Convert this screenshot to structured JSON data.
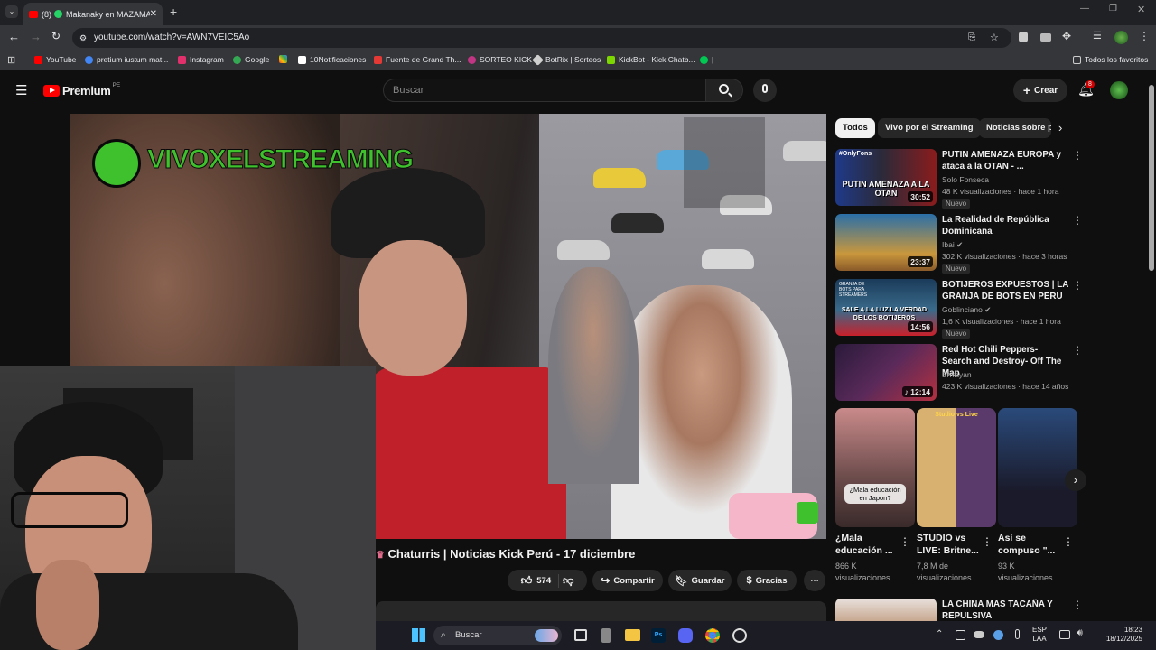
{
  "browser": {
    "tab_title": "Makanaky en MAZAMAN",
    "tab_count_badge": "(8)",
    "url": "youtube.com/watch?v=AWN7VEIC5Ao",
    "bookmarks": [
      "YouTube",
      "pretium iustum mat...",
      "Instagram",
      "Google",
      "10Notificaciones",
      "Fuente de Grand Th...",
      "SORTEO KICK",
      "BotRix | Sorteos",
      "KickBot - Kick Chatb...",
      "Todos los favoritos"
    ],
    "bookmark_colors": [
      "#ff0000",
      "#4285f4",
      "#e1306c",
      "#34a853",
      "#ffffff",
      "#e53935",
      "#c13584",
      "#cfcfcf",
      "#7cd800",
      "#8ab4f8"
    ]
  },
  "youtube": {
    "logo_label": "Premium",
    "region": "PE",
    "search_placeholder": "Buscar",
    "create_label": "Crear",
    "notifications_count": "8"
  },
  "video": {
    "overlay_brand": "VIVOXELSTREAMING",
    "title": "Chaturris | Noticias Kick Perú - 17 diciembre",
    "likes": "574",
    "share_label": "Compartir",
    "save_label": "Guardar",
    "thanks_label": "Gracias"
  },
  "chips": [
    "Todos",
    "Vivo por el Streaming",
    "Noticias sobre p"
  ],
  "recommendations": [
    {
      "title": "PUTIN AMENAZA EUROPA y ataca a la OTAN - ...",
      "channel": "Solo Fonseca",
      "meta": "48 K visualizaciones · hace 1 hora",
      "badge": "Nuevo",
      "duration": "30:52",
      "thumb_text": "PUTIN AMENAZA A LA OTAN",
      "thumb_tag": "#OnlyFons",
      "colors": [
        "#8a1c1c",
        "#1f3a8a"
      ]
    },
    {
      "title": "La Realidad de República Dominicana",
      "channel": "Ibai",
      "meta": "302 K visualizaciones · hace 3 horas",
      "badge": "Nuevo",
      "duration": "23:37",
      "thumb_text": "",
      "thumb_tag": "",
      "colors": [
        "#c9973c",
        "#2a6fa8"
      ]
    },
    {
      "title": "BOTIJEROS EXPUESTOS | LA GRANJA DE BOTS EN PERU",
      "channel": "Goblinciano",
      "meta": "1,6 K visualizaciones · hace 1 hora",
      "badge": "Nuevo",
      "duration": "14:56",
      "thumb_text": "SALE A LA LUZ LA VERDAD DE LOS BOTIJEROS",
      "thumb_tag": "GRANJA DE BOTS PARA STREAMERS",
      "colors": [
        "#1b3b5a",
        "#c8202a"
      ]
    },
    {
      "title": "Red Hot Chili Peppers- Search and Destroy- Off The Map",
      "channel": "Brrrayan",
      "meta": "423 K visualizaciones · hace 14 años",
      "badge": "",
      "duration": "12:14",
      "thumb_text": "",
      "thumb_tag": "",
      "colors": [
        "#2a1a3a",
        "#b23040"
      ]
    }
  ],
  "shorts": [
    {
      "title": "¿Mala educación ...",
      "views": "866 K visualizaciones",
      "overlay": "¿Mala educación en Japon?",
      "colors": [
        "#c98a8a",
        "#3a2a2a"
      ]
    },
    {
      "title": "STUDIO vs LIVE: Britne...",
      "views": "7,8 M de visualizaciones",
      "overlay": "Studio vs Live",
      "colors": [
        "#d8b070",
        "#5a3a6a"
      ]
    },
    {
      "title": "Así se compuso \"...",
      "views": "93 K visualizaciones",
      "overlay": "",
      "colors": [
        "#2a4a7a",
        "#1a1a2a"
      ]
    }
  ],
  "next_rec": {
    "title": "LA CHINA MAS TACAÑA Y REPULSIVA"
  },
  "taskbar": {
    "search_placeholder": "Buscar",
    "lang": "ESP",
    "lang2": "LAA",
    "time": "18:23",
    "date": "18/12/2025"
  }
}
